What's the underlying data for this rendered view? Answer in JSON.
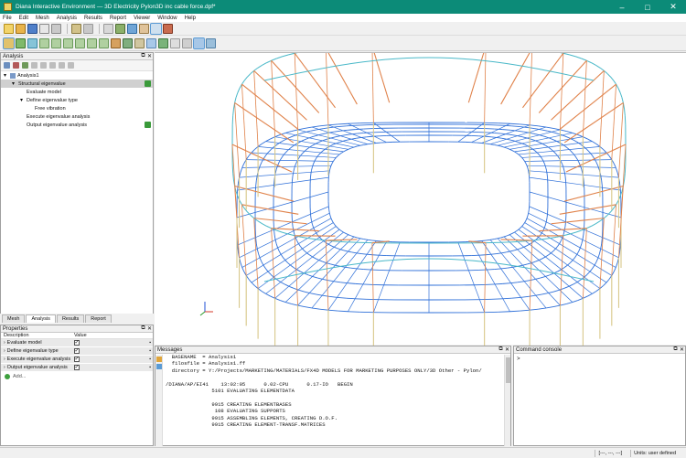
{
  "window": {
    "title": "Diana Interactive Environment — 3D Electricity Pylon3D inc cable force.dpf*",
    "controls": [
      "–",
      "□",
      "✕"
    ]
  },
  "menu": [
    "File",
    "Edit",
    "Mesh",
    "Analysis",
    "Results",
    "Report",
    "Viewer",
    "Window",
    "Help"
  ],
  "analysis_panel": {
    "title": "Analysis",
    "tree": [
      {
        "label": "Analysis1",
        "level": 0,
        "expander": "▾",
        "selected": false,
        "badge": false
      },
      {
        "label": "Structural eigenvalue",
        "level": 1,
        "expander": "▾",
        "selected": true,
        "badge": true
      },
      {
        "label": "Evaluate model",
        "level": 2,
        "expander": "",
        "selected": false,
        "badge": false
      },
      {
        "label": "Define eigenvalue type",
        "level": 2,
        "expander": "▾",
        "selected": false,
        "badge": false
      },
      {
        "label": "Free vibration",
        "level": 3,
        "expander": "",
        "selected": false,
        "badge": false
      },
      {
        "label": "Execute eigenvalue analysis",
        "level": 2,
        "expander": "",
        "selected": false,
        "badge": false
      },
      {
        "label": "Output eigenvalue analysis",
        "level": 2,
        "expander": "",
        "selected": false,
        "badge": true
      }
    ]
  },
  "bottom_tabs": [
    "Mesh",
    "Analysis",
    "Results",
    "Report"
  ],
  "active_bottom_tab": "Analysis",
  "properties": {
    "title": "Properties",
    "col_description": "Description",
    "col_value": "Value",
    "rows": [
      {
        "description": "Evaluate model",
        "checked": true
      },
      {
        "description": "Define eigenvalue type",
        "checked": true
      },
      {
        "description": "Execute eigenvalue analysis",
        "checked": true
      },
      {
        "description": "Output eigenvalue analysis",
        "checked": true
      }
    ],
    "add_label": "Add..."
  },
  "messages": {
    "title": "Messages",
    "lines": [
      "  BASENAME  = Analysis1",
      "  filosfile = Analysis1.ff",
      "  directory = Y:/Projects/MARKETING/MATERIALS/FX4D MODELS FOR MARKETING PURPOSES ONLY/3D Other - Pylon/",
      "",
      "/DIANA/AP/EI41    13:02:05      0.02-CPU      0.17-IO   BEGIN",
      "               5101 EVALUATING ELEMENTDATA",
      "",
      "               9915 CREATING ELEMENTBASES",
      "                108 EVALUATING SUPPORTS",
      "               9915 ASSEMBLING ELEMENTS, CREATING D.O.F.",
      "               9915 CREATING ELEMENT-TRANSF.MATRICES"
    ]
  },
  "command_console": {
    "title": "Command console",
    "prompt": ">"
  },
  "status": {
    "coords": "[---, ---, ---]",
    "units": "Units: user defined"
  },
  "colors": {
    "titlebar": "#0c8b78",
    "roof_truss": "#e0824a",
    "seating": "#2e6fd8",
    "cables": "#49b8c8",
    "columns": "#d8c88a"
  }
}
